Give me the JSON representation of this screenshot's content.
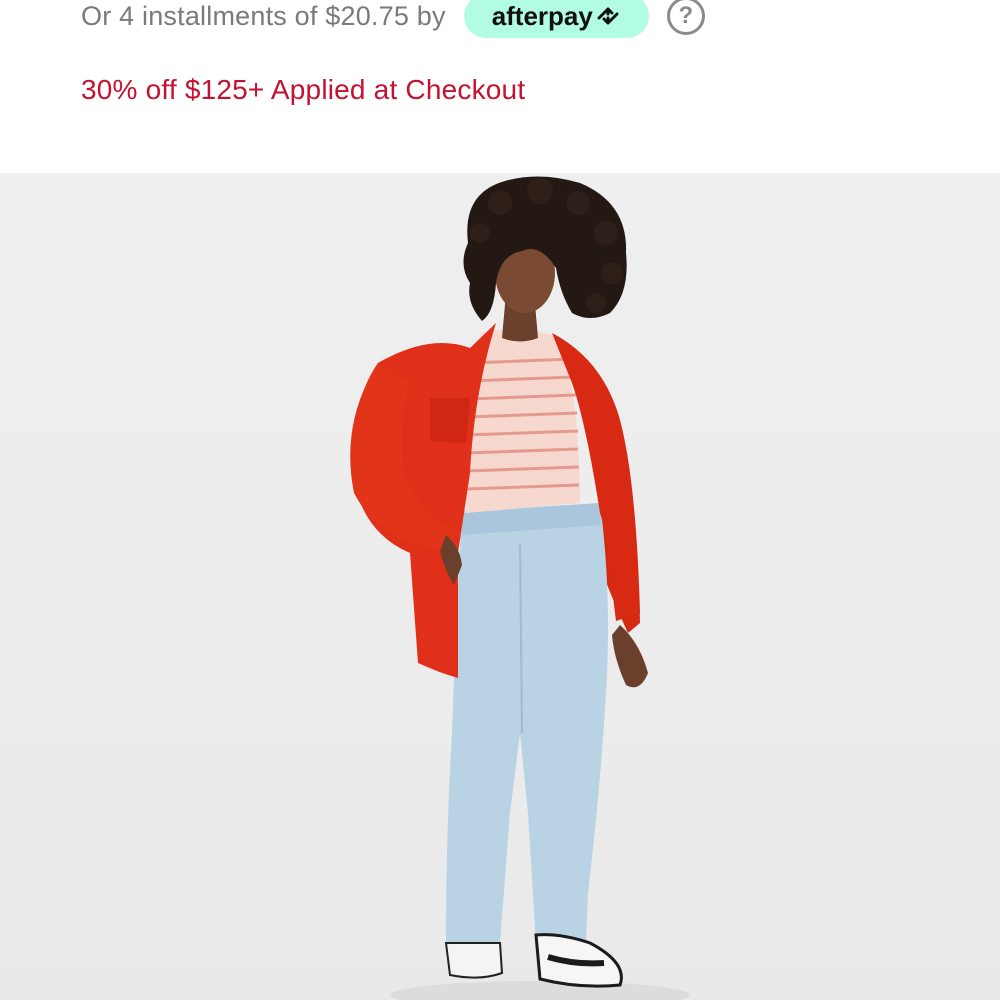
{
  "pricing": {
    "installments_text": "Or 4 installments of $20.75 by",
    "afterpay_label": "afterpay",
    "help_label": "?"
  },
  "promo": {
    "text": "30% off $125+ Applied at Checkout"
  },
  "colors": {
    "afterpay_badge": "#b2fce4",
    "promo_text": "#c41230",
    "muted_text": "#7a7a7a"
  },
  "icons": {
    "afterpay_logo": "afterpay-arrows-icon",
    "help": "question-circle-icon"
  }
}
